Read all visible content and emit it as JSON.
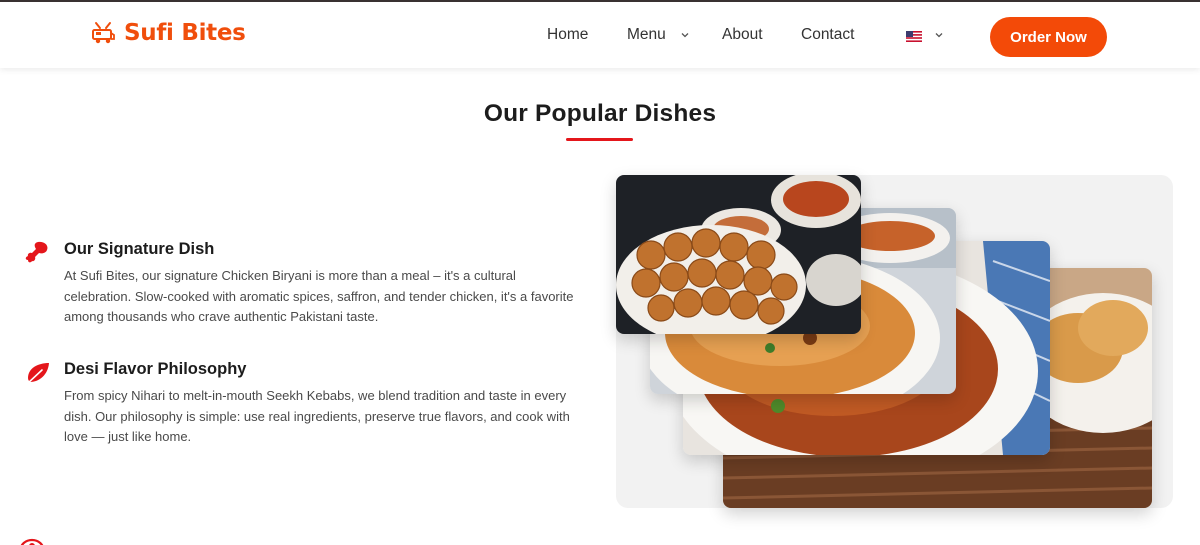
{
  "brand": {
    "name": "Sufi Bites",
    "logo_icon": "food-truck-icon",
    "color": "#f04e0c"
  },
  "nav": {
    "items": [
      {
        "label": "Home"
      },
      {
        "label": "Menu",
        "has_dropdown": true
      },
      {
        "label": "About"
      },
      {
        "label": "Contact"
      }
    ],
    "language_icon": "us-flag-icon",
    "cta_label": "Order Now",
    "cta_color": "#f34a08"
  },
  "section": {
    "title": "Our Popular Dishes",
    "accent": "#e4161b"
  },
  "features": [
    {
      "icon": "chicken-leg-icon",
      "title": "Our Signature Dish",
      "text": "At Sufi Bites, our signature Chicken Biryani is more than a meal – it's a cultural celebration. Slow-cooked with aromatic spices, saffron, and tender chicken, it's a favorite among thousands who crave authentic Pakistani taste."
    },
    {
      "icon": "leaf-icon",
      "title": "Desi Flavor Philosophy",
      "text": "From spicy Nihari to melt-in-mouth Seekh Kebabs, we blend tradition and taste in every dish. Our philosophy is simple: use real ingredients, preserve true flavors, and cook with love — just like home."
    }
  ]
}
